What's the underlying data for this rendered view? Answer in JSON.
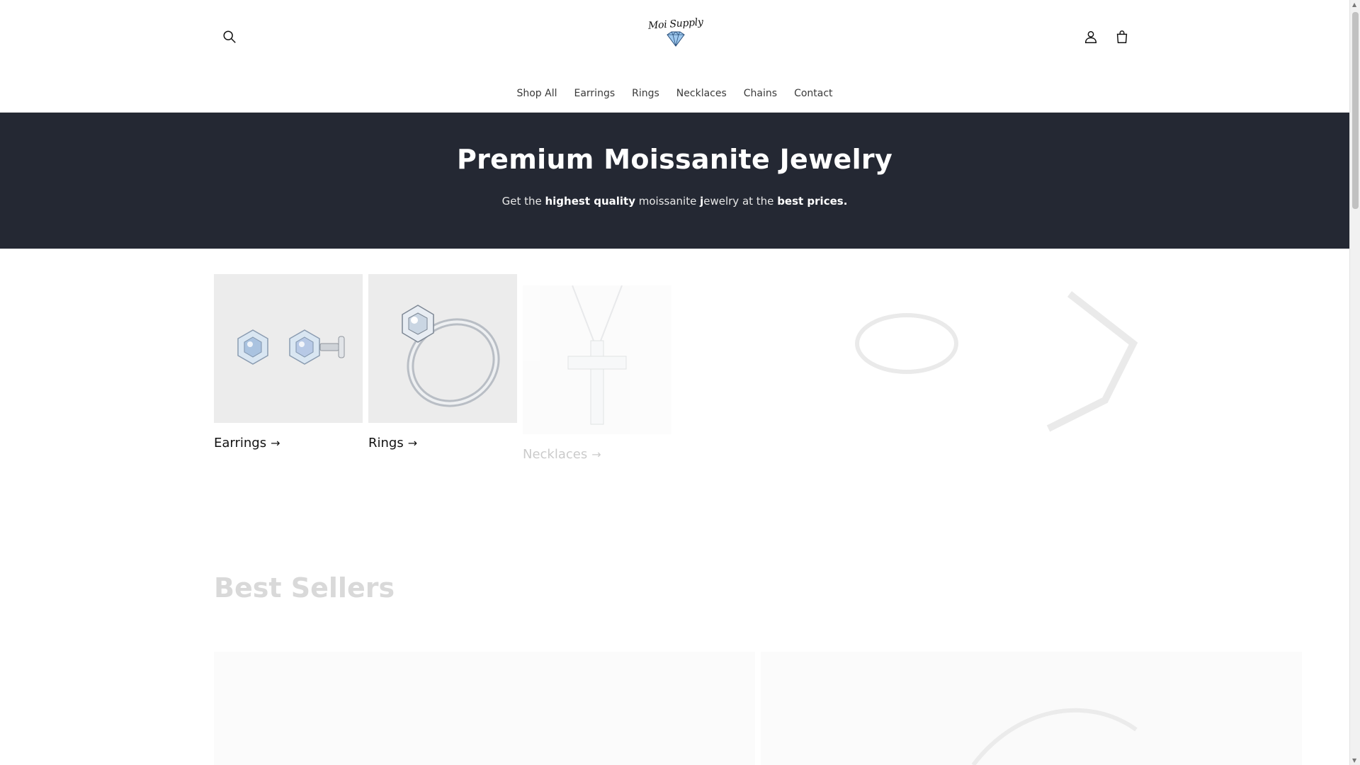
{
  "header": {
    "logo_text": "Moi Supply",
    "nav": [
      {
        "label": "Shop All"
      },
      {
        "label": "Earrings"
      },
      {
        "label": "Rings"
      },
      {
        "label": "Necklaces"
      },
      {
        "label": "Chains"
      },
      {
        "label": "Contact"
      }
    ]
  },
  "hero": {
    "title": "Premium Moissanite Jewelry",
    "subtitle_parts": {
      "p1": "Get the ",
      "b1": "highest quality",
      "p2": " moissanite ",
      "b2": "j",
      "p3": "ewelry at the ",
      "b3": "best prices."
    }
  },
  "collections": [
    {
      "label": "Earrings",
      "arrow": "→"
    },
    {
      "label": "Rings",
      "arrow": "→"
    },
    {
      "label": "Necklaces",
      "arrow": "→"
    }
  ],
  "best_sellers": {
    "title": "Best Sellers"
  },
  "colors": {
    "hero_bg": "#242833",
    "text": "#121212",
    "nav_text": "#3a3a3a"
  },
  "icons": [
    "search-icon",
    "account-icon",
    "cart-icon",
    "arrow-right-icon"
  ]
}
